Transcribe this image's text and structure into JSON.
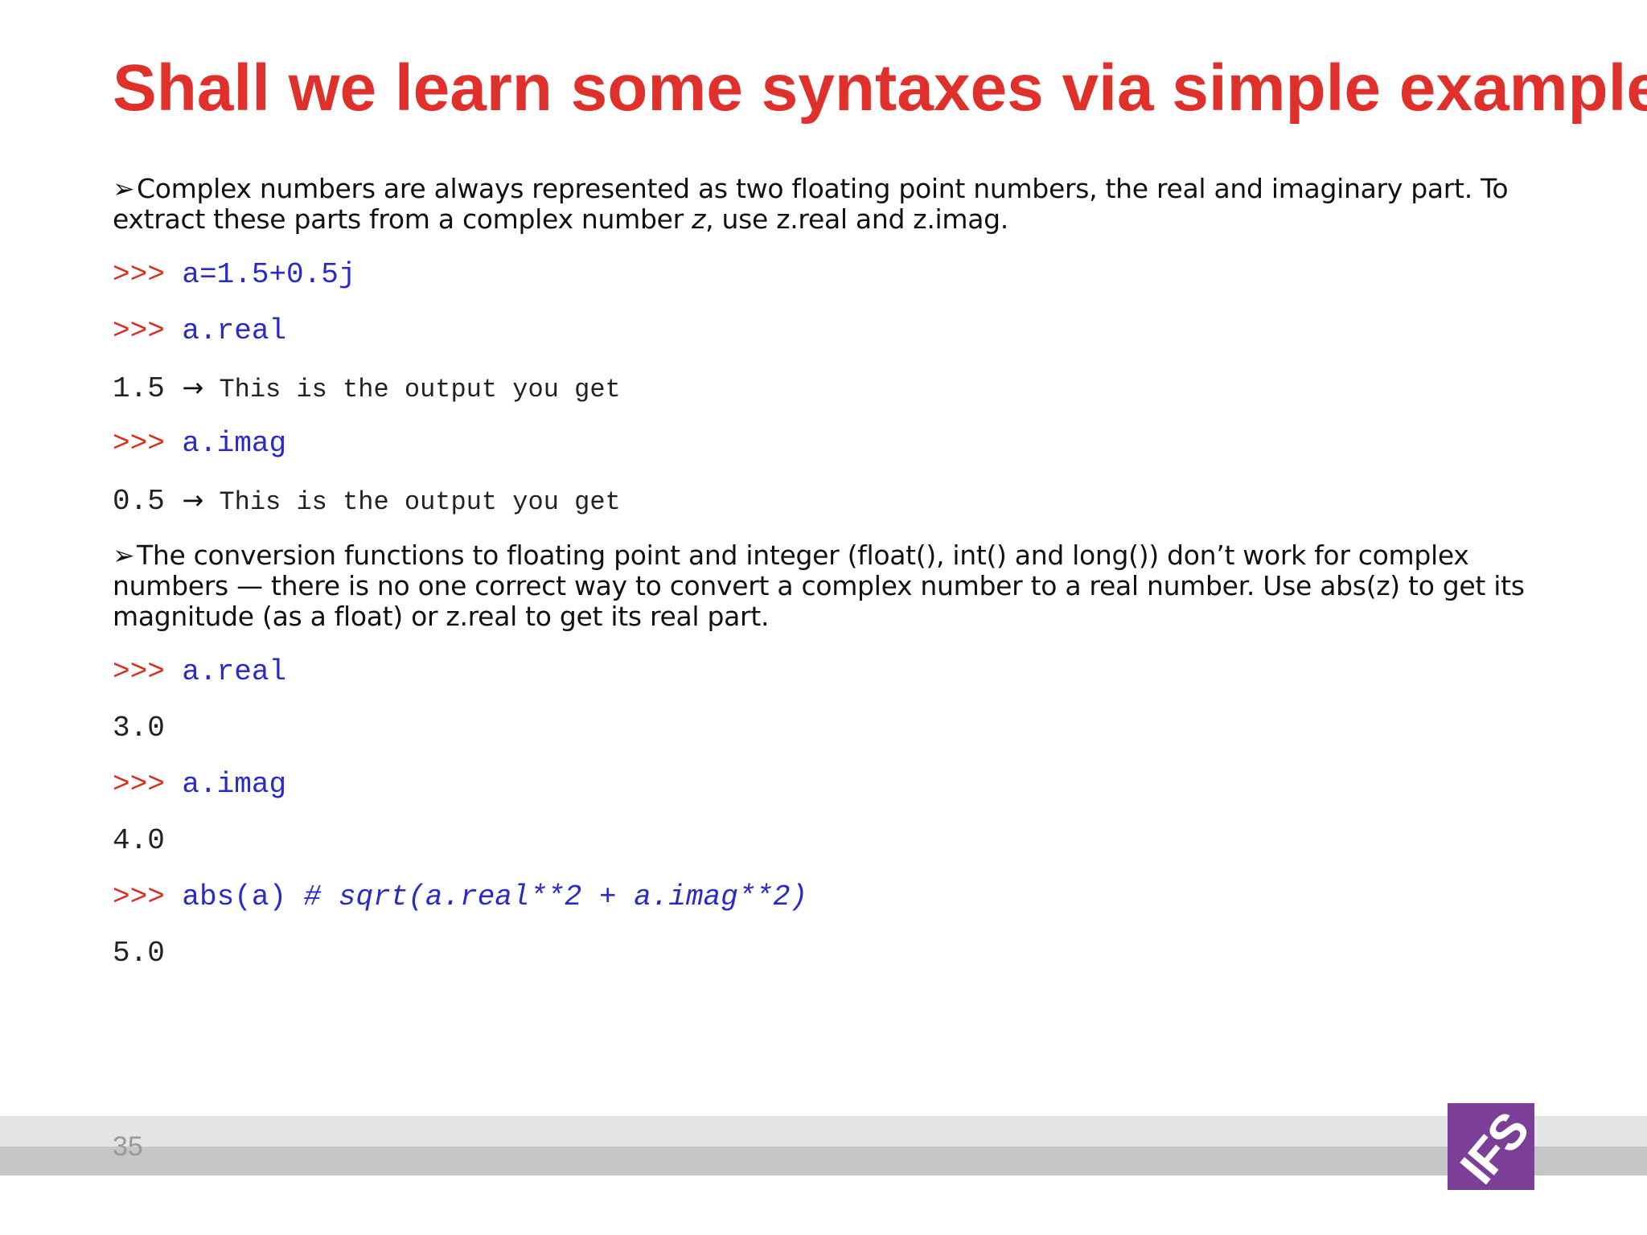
{
  "slide": {
    "title": "Shall we learn some syntaxes via simple examples",
    "page_number": "35",
    "logo_text": "IFS"
  },
  "colors": {
    "title": "#e0302b",
    "prompt": "#d7301f",
    "command": "#2a2ac9",
    "logo_bg": "#7b3f98"
  },
  "icons": {
    "bullet": "arrowhead-bullet-icon",
    "output_arrow": "right-arrow-icon"
  },
  "bullet1": {
    "mark": "➢",
    "text_before": "Complex numbers are always represented as two floating point numbers, the real and imaginary part. To extract these parts from a complex number ",
    "text_italic": "z",
    "text_after": ", use z.real and z.imag."
  },
  "block1": [
    {
      "prompt": ">>> ",
      "cmd": "a=1.5+0.5j"
    },
    {
      "prompt": ">>> ",
      "cmd": "a.real"
    },
    {
      "output": "1.5 ",
      "arrow": "→",
      "note": " This is the output you get"
    },
    {
      "prompt": ">>> ",
      "cmd": "a.imag"
    },
    {
      "output": "0.5 ",
      "arrow": "→",
      "note": " This is the output you get"
    }
  ],
  "bullet2": {
    "mark": "➢",
    "text": "The conversion functions to floating point and integer (float(), int() and long()) don’t work for complex numbers — there is no one correct way to convert a complex number to a real number. Use abs(z) to get its magnitude (as a float) or z.real to get its real part."
  },
  "block2": [
    {
      "prompt": ">>> ",
      "cmd": "a.real"
    },
    {
      "output": "3.0"
    },
    {
      "prompt": ">>> ",
      "cmd": "a.imag"
    },
    {
      "output": "4.0"
    },
    {
      "prompt": ">>> ",
      "cmd": "abs(a) ",
      "comment": "# sqrt(a.real**2 + a.imag**2)"
    },
    {
      "output": "5.0"
    }
  ]
}
